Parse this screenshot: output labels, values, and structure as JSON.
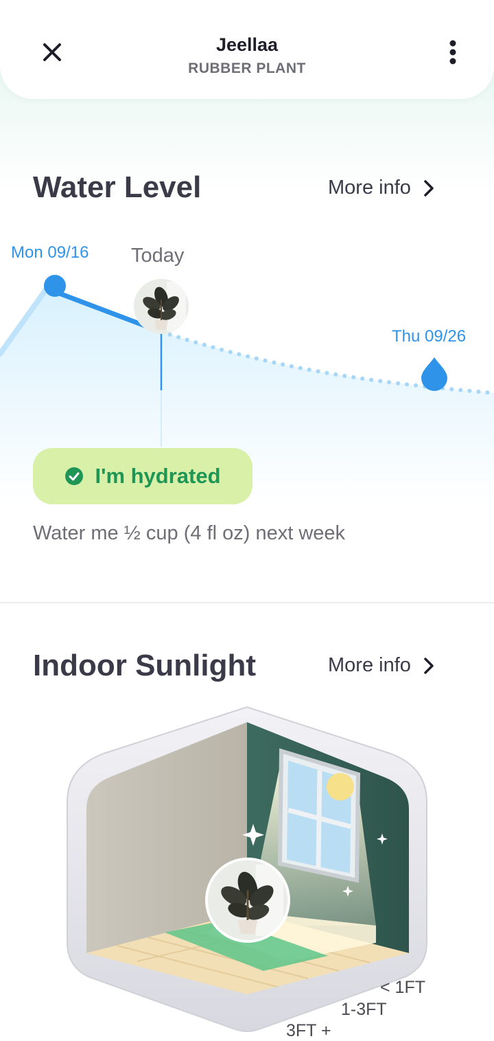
{
  "header": {
    "plant_name": "Jeellaa",
    "plant_type": "RUBBER PLANT",
    "close_icon": "close-icon",
    "menu_icon": "more-vertical-icon"
  },
  "water": {
    "title": "Water Level",
    "more_info": "More info",
    "last_watered": "Mon 09/16",
    "today": "Today",
    "next_water": "Thu 09/26",
    "status": "I'm hydrated",
    "note": "Water me ½ cup (4 fl oz) next week"
  },
  "sunlight": {
    "title": "Indoor Sunlight",
    "more_info": "More info",
    "distances": [
      "< 1FT",
      "1-3FT",
      "3FT +"
    ]
  },
  "colors": {
    "accent": "#2f93ea",
    "status_bg": "#d8f0a8",
    "status_text": "#1f9556",
    "title": "#3a3a48"
  }
}
